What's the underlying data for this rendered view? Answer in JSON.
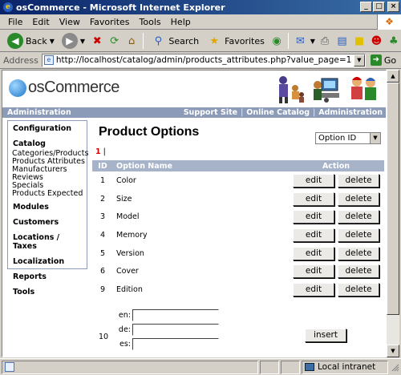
{
  "window": {
    "title": "osCommerce - Microsoft Internet Explorer",
    "ie_icon": "internet-explorer-icon",
    "controls": [
      "minimize",
      "maximize",
      "close"
    ]
  },
  "menubar": {
    "items": [
      "File",
      "Edit",
      "View",
      "Favorites",
      "Tools",
      "Help"
    ]
  },
  "toolbar": {
    "back_label": "Back",
    "search_label": "Search",
    "favorites_label": "Favorites"
  },
  "address": {
    "label": "Address",
    "url": "http://localhost/catalog/admin/products_attributes.php?value_page=1",
    "go_label": "Go"
  },
  "brand": {
    "logo_text": "osCommerce"
  },
  "navbar": {
    "left": "Administration",
    "links": [
      "Support Site",
      "Online Catalog",
      "Administration"
    ],
    "separator": "|"
  },
  "sidebar": {
    "configuration": "Configuration",
    "catalog": "Catalog",
    "catalog_links": [
      "Categories/Products",
      "Products Attributes",
      "Manufacturers",
      "Reviews",
      "Specials",
      "Products Expected"
    ],
    "modules": "Modules",
    "customers": "Customers",
    "locations": "Locations / Taxes",
    "localization": "Localization",
    "reports": "Reports",
    "tools": "Tools"
  },
  "main": {
    "title": "Product Options",
    "sort_select": "Option ID",
    "paging_current": "1",
    "paging_sep": "|",
    "columns": {
      "id": "ID",
      "name": "Option Name",
      "action": "Action"
    },
    "edit_label": "edit",
    "delete_label": "delete",
    "rows": [
      {
        "id": "1",
        "name": "Color"
      },
      {
        "id": "2",
        "name": "Size"
      },
      {
        "id": "3",
        "name": "Model"
      },
      {
        "id": "4",
        "name": "Memory"
      },
      {
        "id": "5",
        "name": "Version"
      },
      {
        "id": "6",
        "name": "Cover"
      },
      {
        "id": "9",
        "name": "Edition"
      }
    ],
    "new_option": {
      "id": "10",
      "languages": [
        "en:",
        "de:",
        "es:"
      ],
      "insert_label": "insert"
    }
  },
  "statusbar": {
    "zone": "Local intranet"
  },
  "colors": {
    "titlebar": "#0a246a",
    "navbar": "#8b9bb8",
    "table_header": "#a6b3c8",
    "paging_current": "#cc0000"
  }
}
